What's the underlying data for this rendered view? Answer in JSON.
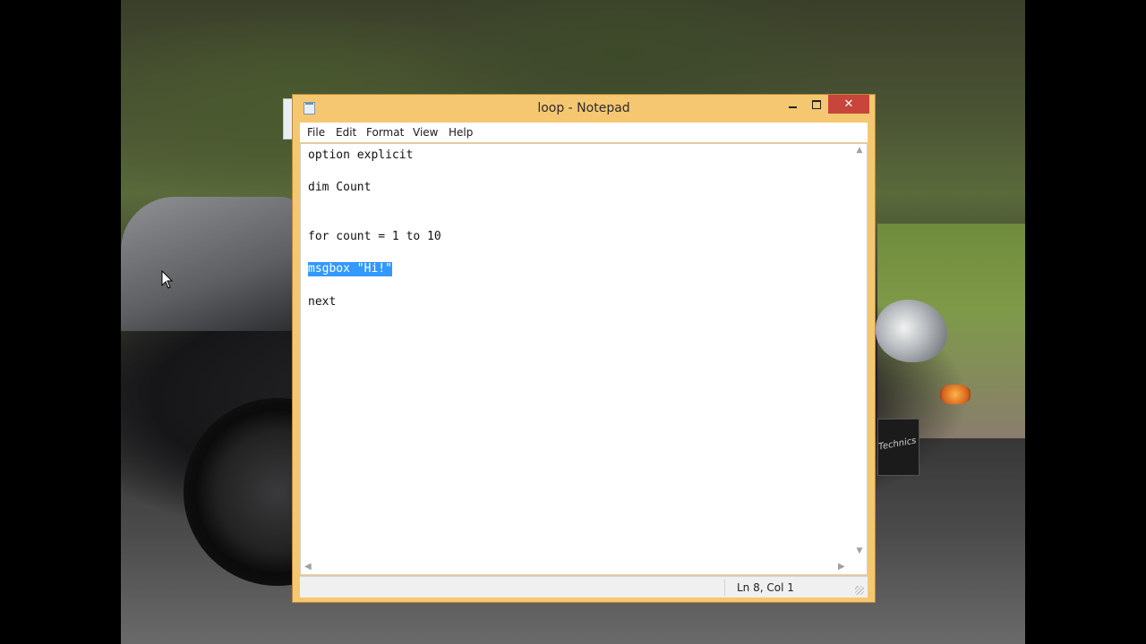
{
  "window": {
    "title": "loop - Notepad",
    "close_glyph": "✕"
  },
  "menu": {
    "file": "File",
    "edit": "Edit",
    "format": "Format",
    "view": "View",
    "help": "Help"
  },
  "editor": {
    "lines": [
      "option explicit",
      "dim Count",
      "for count = 1 to 10",
      "msgbox \"Hi!\"",
      "next"
    ],
    "selected_line": "msgbox \"Hi!\""
  },
  "status": {
    "position": "Ln 8, Col 1"
  },
  "wallpaper": {
    "plate_text": "Technics"
  },
  "colors": {
    "window_frame": "#f5c771",
    "selection": "#3399ff",
    "close_button": "#c7453b"
  },
  "icons": [
    "notepad-icon",
    "minimize-icon",
    "maximize-icon",
    "close-icon",
    "mouse-cursor-icon",
    "scroll-up-icon",
    "scroll-down-icon",
    "scroll-left-icon",
    "scroll-right-icon",
    "resize-grip-icon"
  ]
}
